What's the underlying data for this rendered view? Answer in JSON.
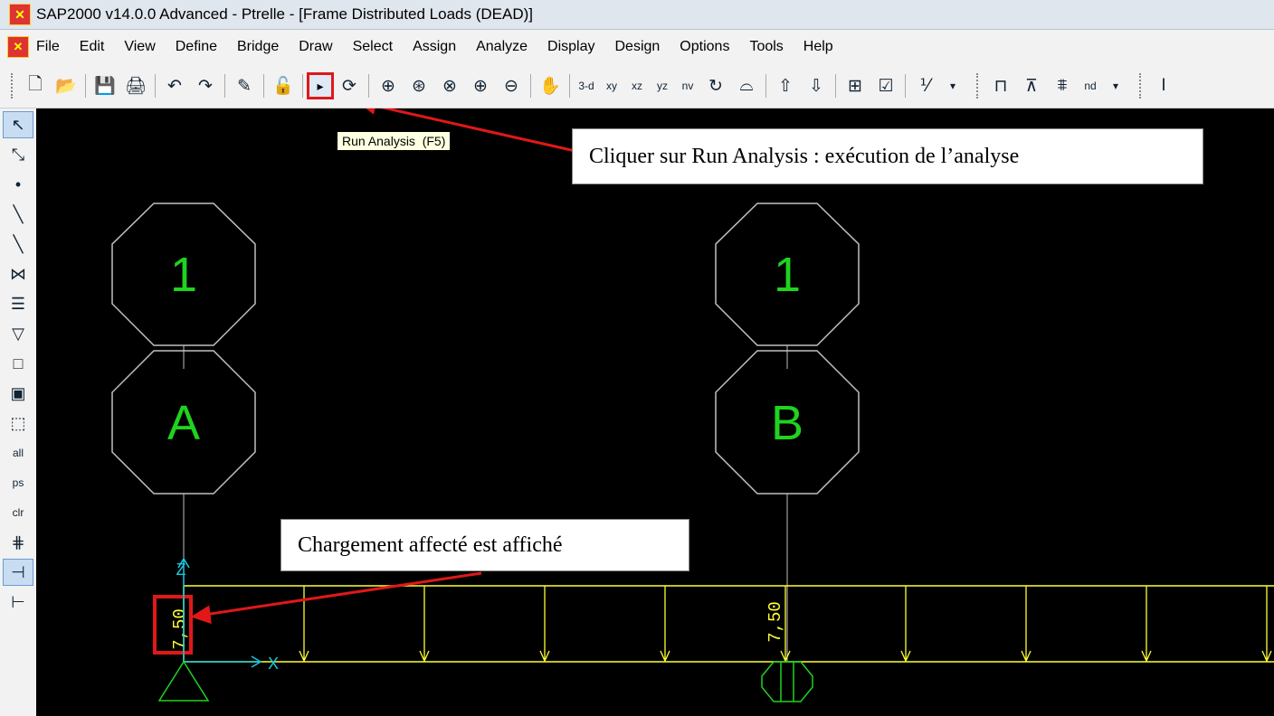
{
  "window": {
    "title": "SAP2000 v14.0.0 Advanced  - Ptrelle - [Frame Distributed Loads (DEAD)]"
  },
  "menu": {
    "items": [
      "File",
      "Edit",
      "View",
      "Define",
      "Bridge",
      "Draw",
      "Select",
      "Assign",
      "Analyze",
      "Display",
      "Design",
      "Options",
      "Tools",
      "Help"
    ]
  },
  "toolbar": {
    "run_tooltip": "Run Analysis  (F5)",
    "view_3d": "3-d",
    "view_xy": "xy",
    "view_xz": "xz",
    "view_yz": "yz",
    "view_nv": "nv",
    "nd_label": "nd"
  },
  "left_toolbar": {
    "all": "all",
    "ps": "ps",
    "clr": "clr"
  },
  "canvas": {
    "grid_top_1": "1",
    "grid_top_2": "1",
    "grid_a": "A",
    "grid_b": "B",
    "axis_z": "Z",
    "axis_x": "X",
    "load_value_1": "7,50",
    "load_value_2": "7,50"
  },
  "annotations": {
    "run_analysis": "Cliquer sur Run Analysis : exécution de l’analyse",
    "load_displayed": "Chargement affecté est affiché"
  },
  "colors": {
    "canvas_bg": "#000000",
    "grid_bubble": "#c0c0c0",
    "grid_label": "#1fd31f",
    "load": "#ffff33",
    "axis": "#19c8e0",
    "support": "#1fd31f",
    "highlight": "#e01818"
  }
}
